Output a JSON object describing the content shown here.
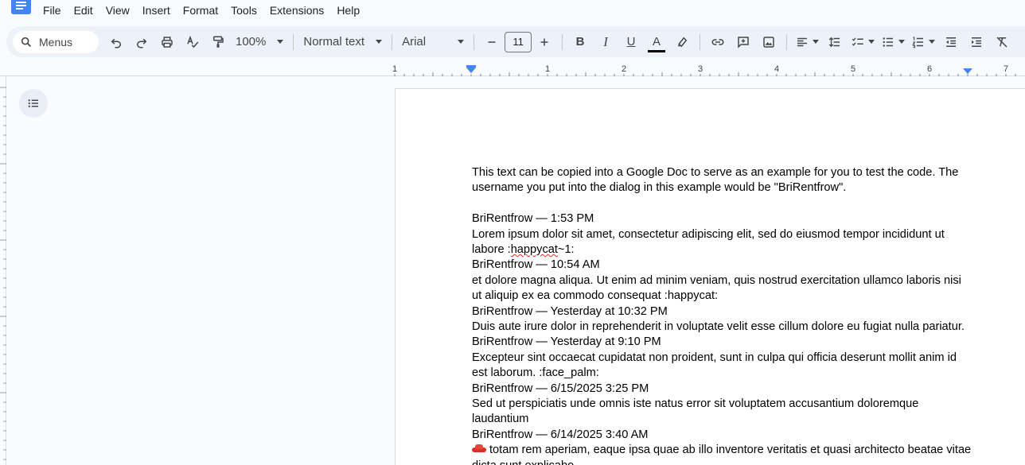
{
  "menubar": [
    "File",
    "Edit",
    "View",
    "Insert",
    "Format",
    "Tools",
    "Extensions",
    "Help"
  ],
  "toolbar": {
    "search_label": "Menus",
    "zoom": "100%",
    "style": "Normal text",
    "font": "Arial",
    "font_size": "11",
    "bold": "B",
    "italic": "I",
    "underline": "U",
    "text_color_label": "A"
  },
  "ruler": {
    "h_labels": [
      "1",
      "1",
      "2",
      "3",
      "4",
      "5",
      "6",
      "7"
    ]
  },
  "document": {
    "intro": "This text can be copied into a Google Doc to serve as an example for you to test the code. The username you put into the dialog in this example would be \"BriRentfrow\".",
    "line1": "BriRentfrow — 1:53 PM",
    "line2a": "Lorem ipsum dolor sit amet, consectetur adipiscing elit, sed do eiusmod tempor incididunt ut labore :",
    "line2b": "happycat",
    "line2c": "~1:",
    "line3": "BriRentfrow — 10:54 AM",
    "line4": "et dolore magna aliqua. Ut enim ad minim veniam, quis nostrud exercitation ullamco laboris nisi ut aliquip ex ea commodo consequat :happycat:",
    "line5": "BriRentfrow — Yesterday at 10:32 PM",
    "line6": "Duis aute irure dolor in reprehenderit in voluptate velit esse cillum dolore eu fugiat nulla pariatur.",
    "line7": "BriRentfrow — Yesterday at 9:10 PM",
    "line8": "Excepteur sint occaecat cupidatat non proident, sunt in culpa qui officia deserunt mollit anim id est laborum. :face_palm:",
    "line9": "BriRentfrow — 6/15/2025 3:25 PM",
    "line10": "Sed ut perspiciatis unde omnis iste natus error sit voluptatem accusantium doloremque laudantium",
    "line11": "BriRentfrow — 6/14/2025 3:40 AM",
    "line12": "totam rem aperiam, eaque ipsa quae ab illo inventore veritatis et quasi architecto beatae vitae dicta sunt explicabo."
  },
  "colors": {
    "toolbar_bg": "#edf2fa",
    "app_bg": "#f9fbfd",
    "brand": "#4285f4",
    "ruler_marker": "#4285f4"
  }
}
